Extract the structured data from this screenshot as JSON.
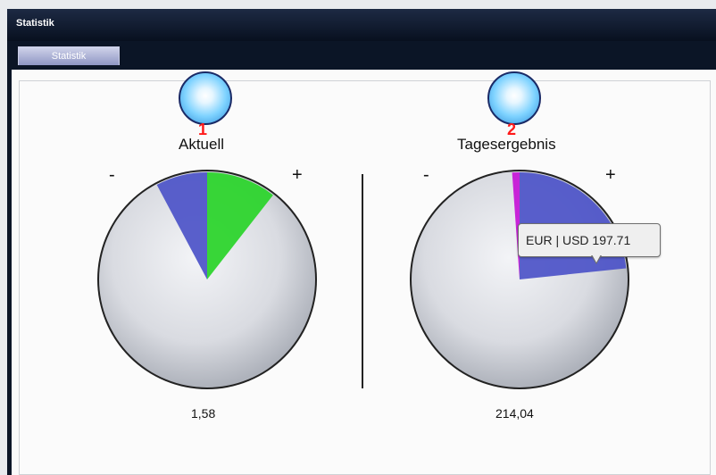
{
  "window": {
    "title": "Statistik"
  },
  "tabs": [
    {
      "label": "Statistik"
    }
  ],
  "markers": [
    {
      "number": "1"
    },
    {
      "number": "2"
    }
  ],
  "charts": {
    "left": {
      "title": "Aktuell",
      "minus": "-",
      "plus": "+",
      "value": "1,58"
    },
    "right": {
      "title": "Tagesergebnis",
      "minus": "-",
      "plus": "+",
      "value": "214,04"
    }
  },
  "tooltip": {
    "text": "EUR | USD 197.71"
  },
  "colors": {
    "green": "#28d428",
    "blue": "#4c52c8",
    "purple": "#c514d6",
    "disc": "#d7d9de"
  },
  "chart_data": [
    {
      "type": "pie",
      "title": "Aktuell",
      "slices": [
        {
          "sign": "-",
          "start_deg": -28,
          "end_deg": 0,
          "color": "#4c52c8"
        },
        {
          "sign": "+",
          "start_deg": 0,
          "end_deg": 38,
          "color": "#28d428"
        }
      ],
      "value": "1,58"
    },
    {
      "type": "pie",
      "title": "Tagesergebnis",
      "slices": [
        {
          "sign": "-",
          "start_deg": -4,
          "end_deg": 0,
          "color": "#c514d6"
        },
        {
          "sign": "+",
          "start_deg": 0,
          "end_deg": 84,
          "color": "#4c52c8"
        }
      ],
      "value": "214,04"
    }
  ]
}
